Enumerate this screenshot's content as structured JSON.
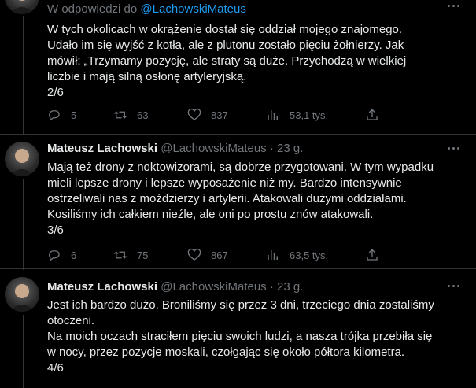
{
  "icons": {
    "reply": "reply-icon",
    "retweet": "retweet-icon",
    "like": "like-icon",
    "views": "views-icon",
    "share": "share-icon",
    "more": "more-icon"
  },
  "colors": {
    "background": "#000000",
    "text": "#e7e9ea",
    "secondary": "#71767b",
    "link": "#1d9bf0",
    "divider": "#2f3336"
  },
  "tweets": [
    {
      "reply_prefix": "W odpowiedzi do",
      "reply_handle": "@LachowskiMateus",
      "lines": [
        "W tych okolicach w okrążenie dostał się oddział mojego znajomego.",
        "Udało im się wyjść z kotła, ale z plutonu zostało pięciu żołnierzy. Jak",
        "mówił: „Trzymamy pozycję, ale straty są duże. Przychodzą w wielkiej",
        "liczbie i mają silną osłonę artyleryjską.",
        "2/6"
      ],
      "stats": {
        "replies": "5",
        "retweets": "63",
        "likes": "837",
        "views": "53,1 tys."
      }
    },
    {
      "name": "Mateusz Lachowski",
      "handle": "@LachowskiMateus",
      "separator": "·",
      "time": "23 g.",
      "lines": [
        "Mają też drony z noktowizorami, są dobrze przygotowani. W tym wypadku",
        "mieli lepsze drony i lepsze wyposażenie niż my. Bardzo intensywnie",
        "ostrzeliwali nas z moździerzy i artylerii. Atakowali dużymi oddziałami.",
        "Kosiliśmy ich całkiem nieźle, ale oni po prostu znów atakowali.",
        "3/6"
      ],
      "stats": {
        "replies": "6",
        "retweets": "75",
        "likes": "867",
        "views": "63,5 tys."
      }
    },
    {
      "name": "Mateusz Lachowski",
      "handle": "@LachowskiMateus",
      "separator": "·",
      "time": "23 g.",
      "lines": [
        "Jest ich bardzo dużo. Broniliśmy się przez 3 dni, trzeciego dnia zostaliśmy",
        "otoczeni.",
        "Na moich oczach straciłem pięciu swoich ludzi, a nasza trójka przebiła się",
        "w nocy, przez pozycje moskali, czołgając się około półtora kilometra.",
        "4/6"
      ]
    }
  ]
}
